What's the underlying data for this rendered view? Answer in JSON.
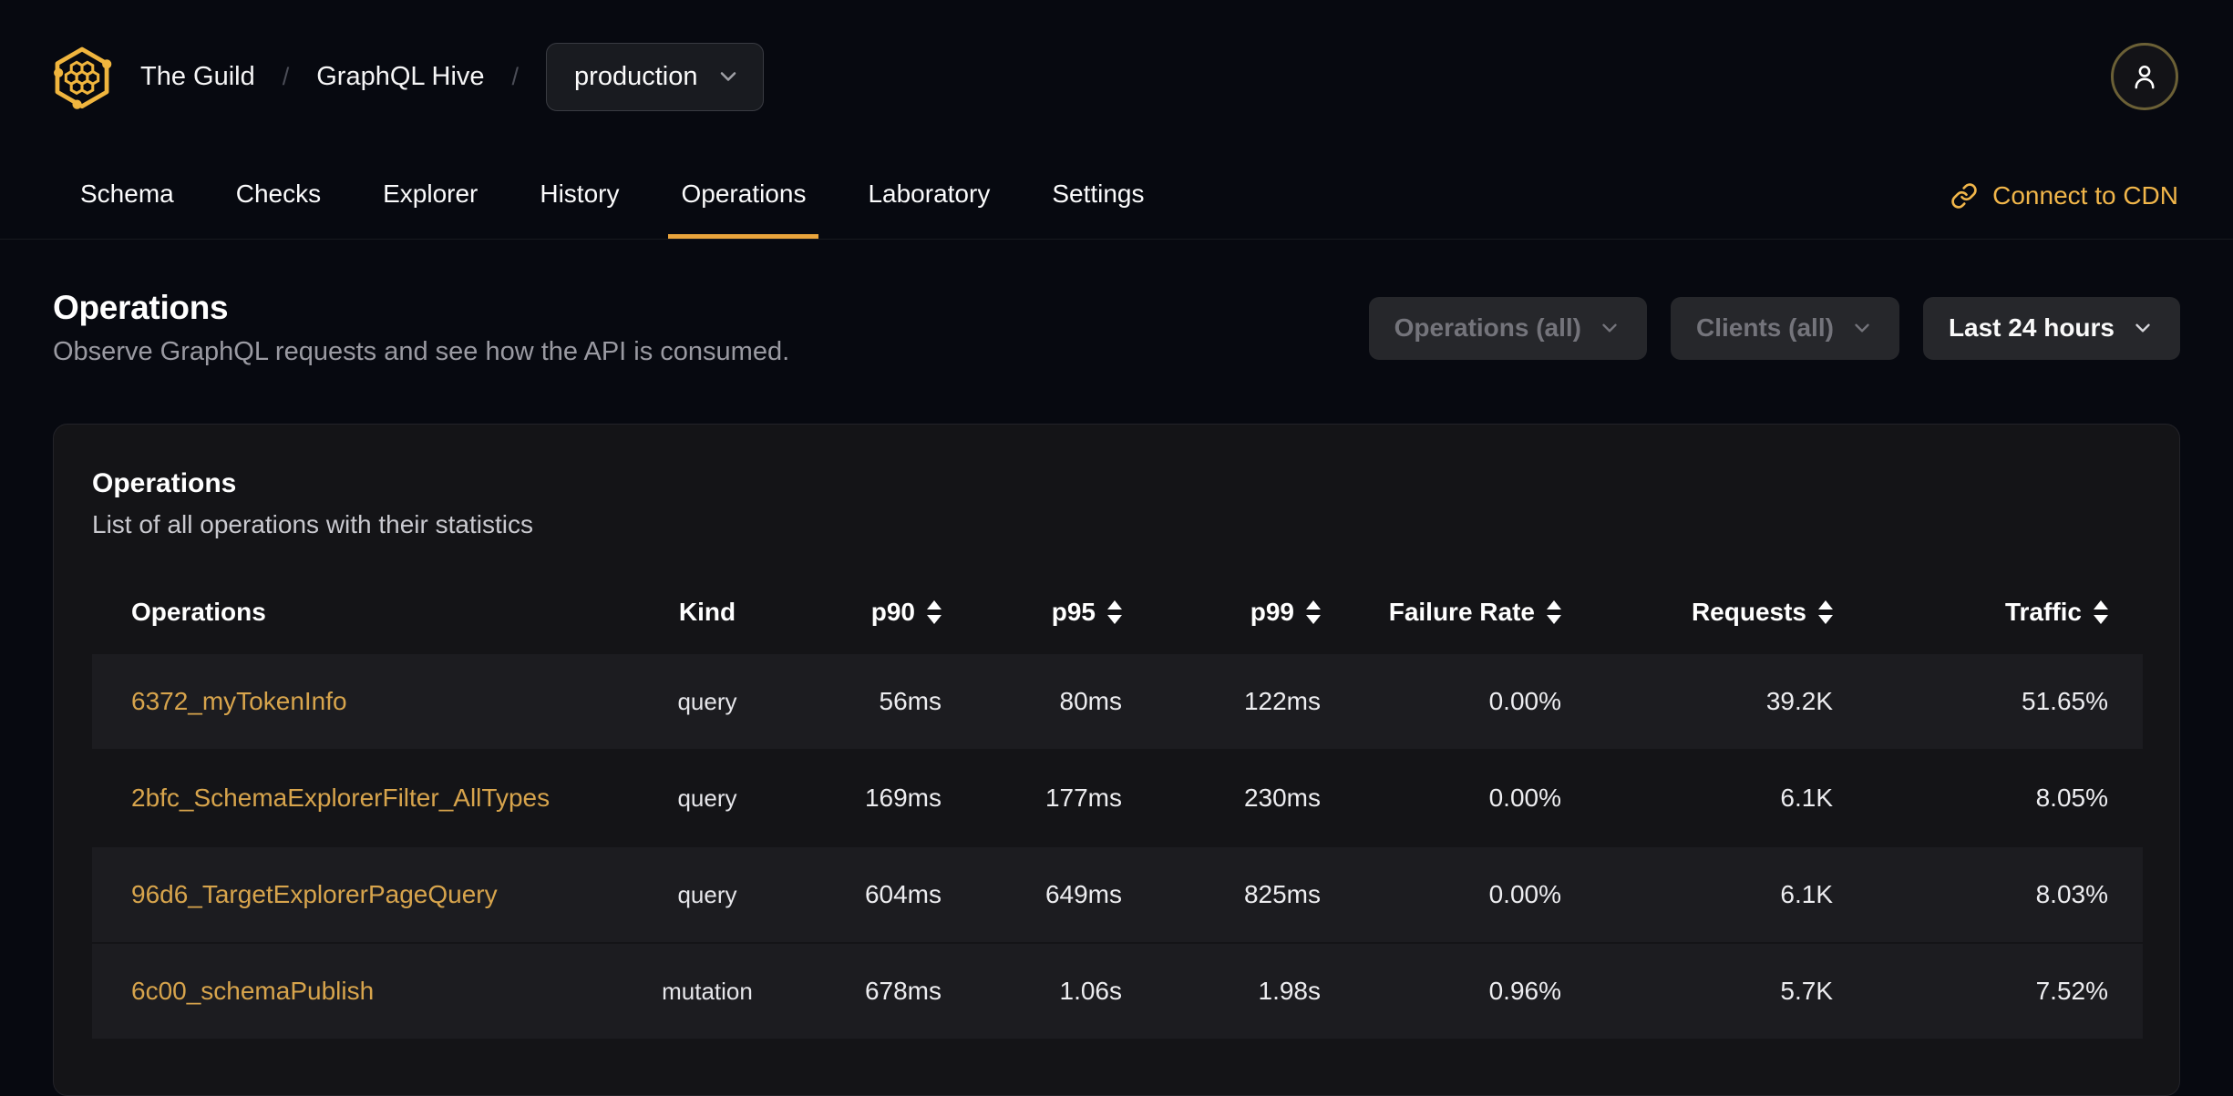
{
  "header": {
    "org": "The Guild",
    "separator": "/",
    "project": "GraphQL Hive",
    "target_selector": "production",
    "nav_tabs": [
      {
        "label": "Schema",
        "active": false
      },
      {
        "label": "Checks",
        "active": false
      },
      {
        "label": "Explorer",
        "active": false
      },
      {
        "label": "History",
        "active": false
      },
      {
        "label": "Operations",
        "active": true
      },
      {
        "label": "Laboratory",
        "active": false
      },
      {
        "label": "Settings",
        "active": false
      }
    ],
    "connect_cdn": "Connect to CDN"
  },
  "page": {
    "title": "Operations",
    "subtitle": "Observe GraphQL requests and see how the API is consumed.",
    "filters": {
      "operations": "Operations (all)",
      "clients": "Clients (all)",
      "period": "Last 24 hours"
    }
  },
  "card": {
    "title": "Operations",
    "subtitle": "List of all operations with their statistics"
  },
  "table": {
    "columns": [
      {
        "label": "Operations",
        "key": "operation",
        "sortable": false,
        "align": "left"
      },
      {
        "label": "Kind",
        "key": "kind",
        "sortable": false,
        "align": "center"
      },
      {
        "label": "p90",
        "key": "p90",
        "sortable": true,
        "align": "right"
      },
      {
        "label": "p95",
        "key": "p95",
        "sortable": true,
        "align": "right"
      },
      {
        "label": "p99",
        "key": "p99",
        "sortable": true,
        "align": "right"
      },
      {
        "label": "Failure Rate",
        "key": "failure_rate",
        "sortable": true,
        "align": "right"
      },
      {
        "label": "Requests",
        "key": "requests",
        "sortable": true,
        "align": "right"
      },
      {
        "label": "Traffic",
        "key": "traffic",
        "sortable": true,
        "align": "right"
      }
    ],
    "rows": [
      {
        "operation": "6372_myTokenInfo",
        "kind": "query",
        "p90": "56ms",
        "p95": "80ms",
        "p99": "122ms",
        "failure_rate": "0.00%",
        "requests": "39.2K",
        "traffic": "51.65%",
        "striped": true
      },
      {
        "operation": "2bfc_SchemaExplorerFilter_AllTypes",
        "kind": "query",
        "p90": "169ms",
        "p95": "177ms",
        "p99": "230ms",
        "failure_rate": "0.00%",
        "requests": "6.1K",
        "traffic": "8.05%",
        "striped": false
      },
      {
        "operation": "96d6_TargetExplorerPageQuery",
        "kind": "query",
        "p90": "604ms",
        "p95": "649ms",
        "p99": "825ms",
        "failure_rate": "0.00%",
        "requests": "6.1K",
        "traffic": "8.03%",
        "striped": true
      },
      {
        "operation": "6c00_schemaPublish",
        "kind": "mutation",
        "p90": "678ms",
        "p95": "1.06s",
        "p99": "1.98s",
        "failure_rate": "0.96%",
        "requests": "5.7K",
        "traffic": "7.52%",
        "striped": true
      }
    ]
  },
  "colors": {
    "page_background": "#070910",
    "card_background": "#141417",
    "row_stripe": "#1c1c20",
    "accent_gold": "#f1b64a",
    "operation_link_gold": "#d7a44c",
    "tab_underline": "#e9a43c",
    "muted_text": "#9a9aa2"
  }
}
